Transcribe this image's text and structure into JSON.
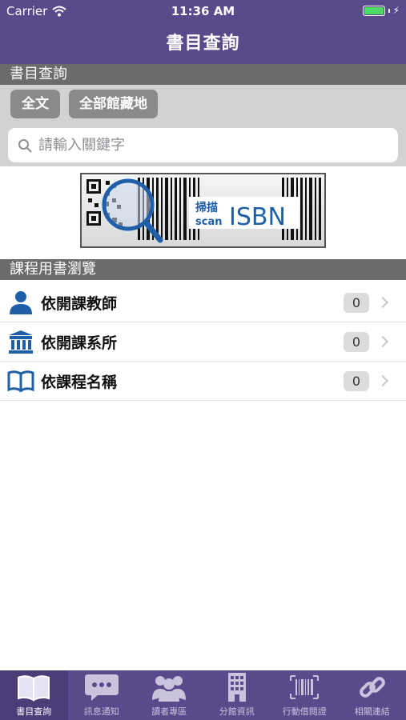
{
  "status": {
    "carrier": "Carrier",
    "time": "11:36 AM"
  },
  "nav": {
    "title": "書目查詢"
  },
  "search_section": {
    "header": "書目查詢"
  },
  "scope": {
    "full_text": "全文",
    "all_locations": "全部館藏地"
  },
  "search": {
    "placeholder": "請輸入關鍵字"
  },
  "scan": {
    "top_text": "掃描",
    "scan_word": "scan",
    "isbn": "ISBN"
  },
  "browse_section": {
    "header": "課程用書瀏覽"
  },
  "list": {
    "items": [
      {
        "label": "依開課教師",
        "count": "0",
        "icon": "person-icon"
      },
      {
        "label": "依開課系所",
        "count": "0",
        "icon": "building-icon"
      },
      {
        "label": "依課程名稱",
        "count": "0",
        "icon": "book-icon"
      }
    ]
  },
  "tabs": [
    {
      "label": "書目查詢",
      "icon": "book-icon",
      "active": true
    },
    {
      "label": "訊息通知",
      "icon": "chat-bubble-icon",
      "active": false
    },
    {
      "label": "讀者專區",
      "icon": "users-icon",
      "active": false
    },
    {
      "label": "分館資訊",
      "icon": "building-icon",
      "active": false
    },
    {
      "label": "行動借閱證",
      "icon": "barcode-icon",
      "active": false
    },
    {
      "label": "相關連結",
      "icon": "link-icon",
      "active": false
    }
  ],
  "colors": {
    "brand": "#5a4a8c",
    "section": "#6b6b6b",
    "search_bg": "#d2d2d2",
    "icon_blue": "#1e5fa8"
  }
}
